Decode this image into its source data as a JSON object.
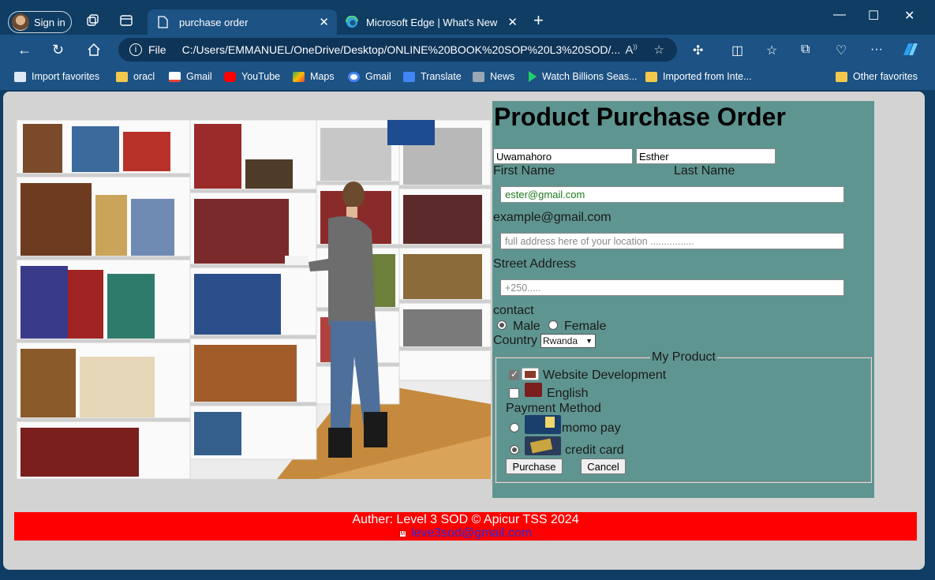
{
  "browser": {
    "signin_label": "Sign in",
    "tabs": [
      {
        "title": "purchase order",
        "active": true
      },
      {
        "title": "Microsoft Edge | What's New",
        "active": false
      }
    ],
    "address": {
      "prefix": "File",
      "url": "C:/Users/EMMANUEL/OneDrive/Desktop/ONLINE%20BOOK%20SOP%20L3%20SOD/..."
    },
    "favorites": [
      {
        "label": "Import favorites",
        "icon": "import-icon"
      },
      {
        "label": "oracl",
        "icon": "folder-icon"
      },
      {
        "label": "Gmail",
        "icon": "gmail-icon"
      },
      {
        "label": "YouTube",
        "icon": "youtube-icon"
      },
      {
        "label": "Maps",
        "icon": "maps-icon"
      },
      {
        "label": "Gmail",
        "icon": "google-icon"
      },
      {
        "label": "Translate",
        "icon": "translate-icon"
      },
      {
        "label": "News",
        "icon": "news-icon"
      },
      {
        "label": "Watch Billions Seas...",
        "icon": "play-icon"
      },
      {
        "label": "Imported from Inte...",
        "icon": "folder-icon"
      },
      {
        "label": "Other favorites",
        "icon": "folder-icon"
      }
    ]
  },
  "form": {
    "title": "Product Purchase Order",
    "first_name_value": "Uwamahoro",
    "last_name_value": "Esther",
    "first_name_label": "First Name",
    "last_name_label": "Last Name",
    "email_value": "ester@gmail.com",
    "email_label": "example@gmail.com",
    "address_placeholder": "full address here of your location ................",
    "address_label": "Street Address",
    "contact_placeholder": "+250.....",
    "contact_label": "contact",
    "gender": {
      "male": "Male",
      "female": "Female",
      "selected": "Male"
    },
    "country_label": "Country",
    "country_value": "Rwanda",
    "product_legend": "My Product",
    "products": [
      {
        "label": "Website Development",
        "checked": true
      },
      {
        "label": "English",
        "checked": false
      }
    ],
    "payment_label": "Payment Method",
    "payments": [
      {
        "label": "momo pay",
        "selected": false
      },
      {
        "label": "credit card",
        "selected": true
      }
    ],
    "purchase_label": "Purchase",
    "cancel_label": "Cancel"
  },
  "footer": {
    "author": "Auther: Level 3 SOD © Apicur TSS 2024",
    "email": "leve3sod@gmail.com"
  },
  "colors": {
    "form_bg": "#5f9591",
    "footer_bg": "#ff0000",
    "page_bg": "#d3d3d3",
    "chrome": "#1c5284"
  }
}
